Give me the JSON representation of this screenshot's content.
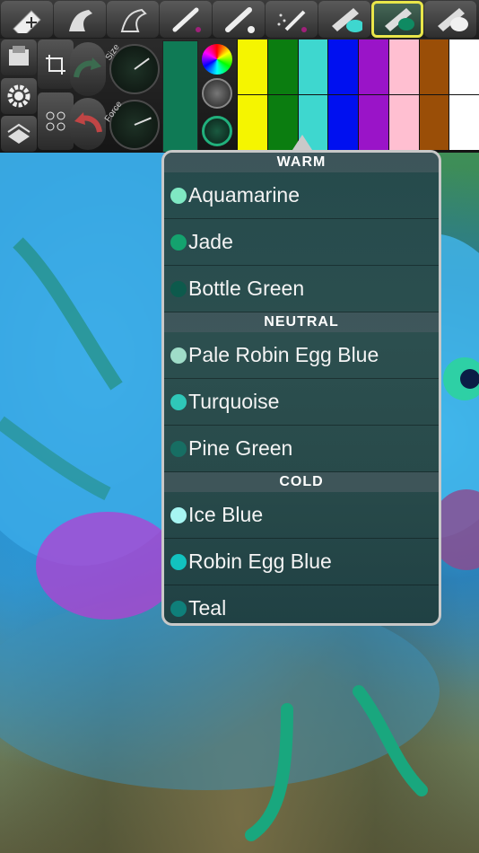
{
  "popup": {
    "sections": [
      {
        "title": "WARM",
        "items": [
          {
            "name": "Aquamarine",
            "color": "#7fe8c3"
          },
          {
            "name": "Jade",
            "color": "#14a26e"
          },
          {
            "name": "Bottle Green",
            "color": "#0d5a4c"
          }
        ]
      },
      {
        "title": "NEUTRAL",
        "items": [
          {
            "name": "Pale Robin Egg Blue",
            "color": "#9fdcc8"
          },
          {
            "name": "Turquoise",
            "color": "#2fc7b8"
          },
          {
            "name": "Pine Green",
            "color": "#176e63"
          }
        ]
      },
      {
        "title": "COLD",
        "items": [
          {
            "name": "Ice Blue",
            "color": "#a6f5f2"
          },
          {
            "name": "Robin Egg Blue",
            "color": "#12c2bf"
          },
          {
            "name": "Teal",
            "color": "#0f7f7a"
          }
        ]
      }
    ]
  },
  "controls": {
    "size_label": "Size",
    "force_label": "Force",
    "size_level": 0.7,
    "force_level": 0.75
  },
  "colors": {
    "current_color": "#0f7a55",
    "palette": [
      [
        "#f5f500",
        "#f5f500"
      ],
      [
        "#0b7d10",
        "#0b7d10"
      ],
      [
        "#3ed7cf",
        "#3ed7cf"
      ],
      [
        "#0010f0",
        "#0010f0"
      ],
      [
        "#9a14c8",
        "#9a14c8"
      ],
      [
        "#ffbfd1",
        "#ffbfd1"
      ],
      [
        "#9a4e07",
        "#9a4e07"
      ],
      [
        "#ffffff",
        "#ffffff"
      ]
    ]
  },
  "tools": [
    {
      "icon": "eraser-add-icon"
    },
    {
      "icon": "smudge-hand-icon"
    },
    {
      "icon": "smudge-hand-outline-icon"
    },
    {
      "icon": "pencil-icon"
    },
    {
      "icon": "brush-icon"
    },
    {
      "icon": "spray-icon"
    },
    {
      "icon": "marker-icon"
    },
    {
      "icon": "paint-brush-selected-icon"
    },
    {
      "icon": "blend-brush-icon"
    }
  ]
}
